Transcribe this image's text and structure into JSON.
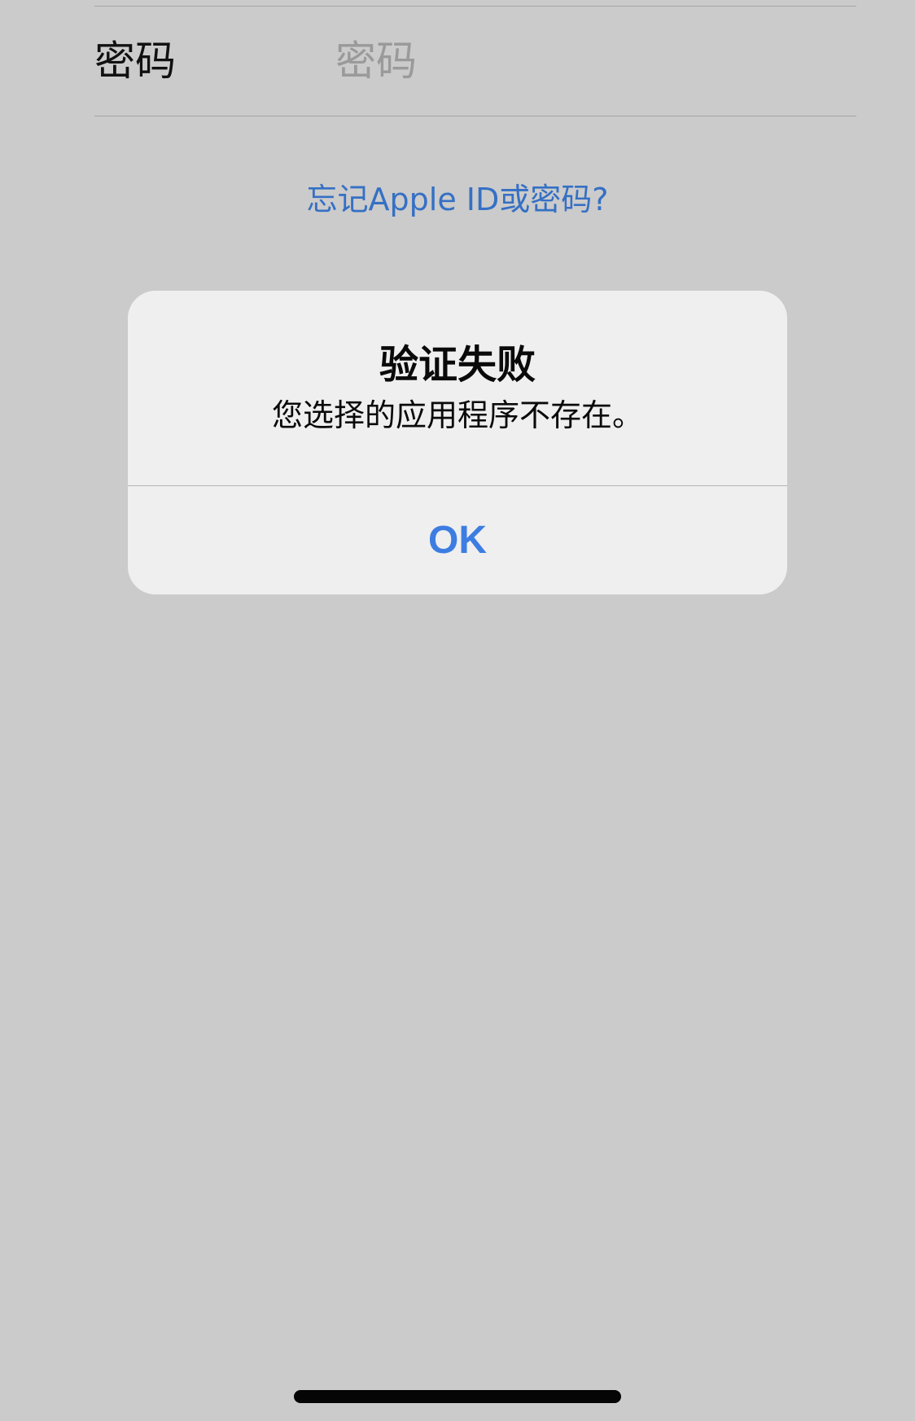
{
  "login_form": {
    "password_label": "密码",
    "password_placeholder": "密码",
    "forgot_link": "忘记Apple ID或密码?"
  },
  "alert": {
    "title": "验证失败",
    "message": "您选择的应用程序不存在。",
    "ok_label": "OK"
  },
  "colors": {
    "background": "#cbcbcb",
    "alert_background": "#efefef",
    "link_blue": "#3570c4",
    "button_blue": "#3d7de2"
  }
}
